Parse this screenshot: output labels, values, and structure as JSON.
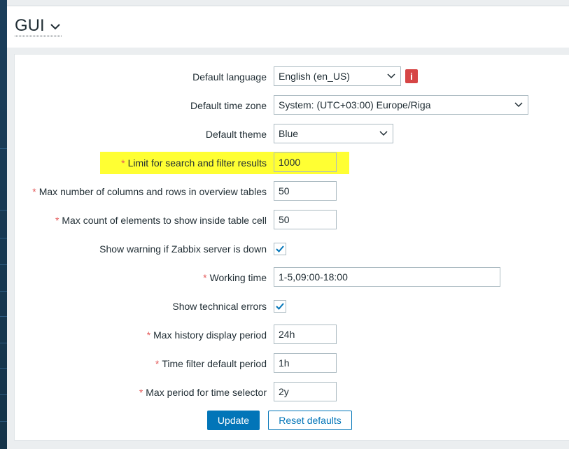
{
  "page": {
    "title": "GUI"
  },
  "form": {
    "default_language": {
      "label": "Default language",
      "value": "English (en_US)",
      "info_icon": "i"
    },
    "default_time_zone": {
      "label": "Default time zone",
      "value": "System: (UTC+03:00) Europe/Riga"
    },
    "default_theme": {
      "label": "Default theme",
      "value": "Blue"
    },
    "search_limit": {
      "label": "Limit for search and filter results",
      "value": "1000",
      "required": true,
      "highlighted": true
    },
    "max_overview": {
      "label": "Max number of columns and rows in overview tables",
      "value": "50",
      "required": true
    },
    "max_in_table": {
      "label": "Max count of elements to show inside table cell",
      "value": "50",
      "required": true
    },
    "server_check": {
      "label": "Show warning if Zabbix server is down",
      "checked": true
    },
    "work_period": {
      "label": "Working time",
      "value": "1-5,09:00-18:00",
      "required": true
    },
    "show_technical_errors": {
      "label": "Show technical errors",
      "checked": true
    },
    "history_period": {
      "label": "Max history display period",
      "value": "24h",
      "required": true
    },
    "period_default": {
      "label": "Time filter default period",
      "value": "1h",
      "required": true
    },
    "max_period": {
      "label": "Max period for time selector",
      "value": "2y",
      "required": true
    },
    "required_marker": "*"
  },
  "buttons": {
    "update": "Update",
    "reset": "Reset defaults"
  },
  "colors": {
    "accent": "#0275b8",
    "highlight": "#ffff33",
    "required": "#e45959",
    "info": "#d64545"
  }
}
